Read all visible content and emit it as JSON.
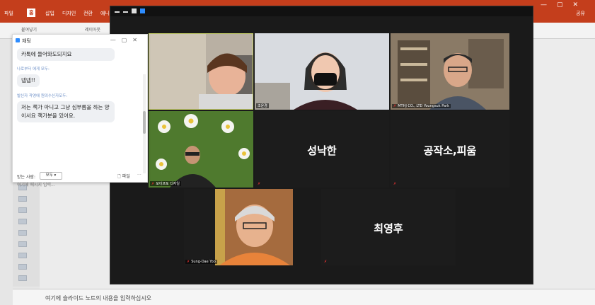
{
  "ppt": {
    "title_fragment": "",
    "ribbon_tabs": [
      "파일",
      "홈",
      "삽입",
      "디자인",
      "전환",
      "애니"
    ],
    "active_tab_index": 1,
    "share_label": "공유",
    "clipboard_label": "붙여넣기",
    "layout_label": "레이아웃",
    "notes_placeholder": "여기에 슬라이드 노트의 내용을 입력하십시오"
  },
  "chat": {
    "title": "채팅",
    "messages": [
      {
        "meta": "",
        "text": "카톡에 들어와도되지요"
      },
      {
        "meta": "나로부터 에게 모두:",
        "text": "넵넵!!"
      },
      {
        "meta": "발신자 곽영애 원의수신자모두:",
        "text": "저는 책가 아니고 그냥 심부름을 하는 양이서요 책가분을 있어요."
      }
    ],
    "to_label": "받는 사람:",
    "to_value": "모두",
    "file_label": "파일",
    "more_label": "···",
    "input_placeholder": "여기에 메시지 입력..."
  },
  "zoom": {
    "participants": [
      {
        "name": "",
        "muted": false,
        "type": "video"
      },
      {
        "name": "조윤경",
        "muted": false,
        "type": "video"
      },
      {
        "name": "MTHJ CO., LTD Youngsuk Park",
        "muted": true,
        "type": "video"
      },
      {
        "name": "포이프토 디자일",
        "muted": true,
        "type": "video"
      },
      {
        "name": "성낙한",
        "muted": true,
        "type": "name"
      },
      {
        "name": "공작소,피움",
        "muted": true,
        "type": "name"
      },
      {
        "name": "Sung-Dae Yoo",
        "muted": true,
        "type": "video"
      },
      {
        "name": "최영후",
        "muted": true,
        "type": "name"
      }
    ],
    "colors": {
      "bg": "#1a1a1a",
      "tile": "#1c1c1c",
      "speaker_border": "#c9d36a",
      "mute": "#e03030"
    }
  },
  "icons": [
    "chat-icon",
    "close-icon",
    "minimize-icon",
    "file-icon",
    "mute-icon",
    "dropdown-icon"
  ]
}
